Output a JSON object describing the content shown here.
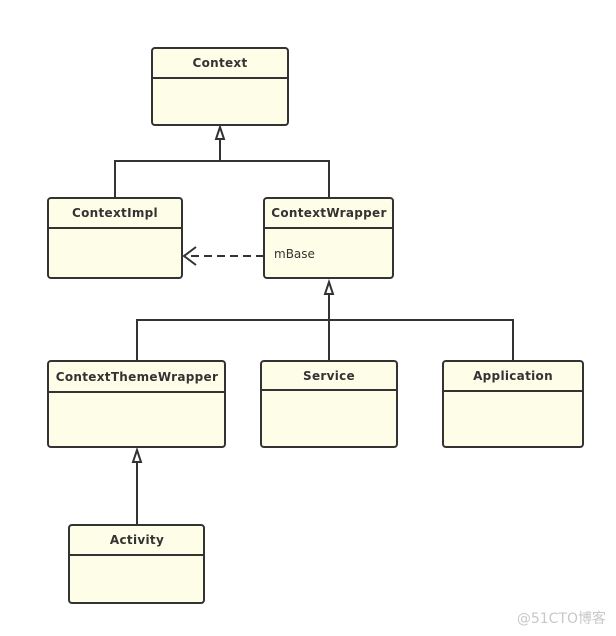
{
  "diagram": {
    "type": "uml-class-diagram",
    "classes": [
      {
        "id": "context",
        "name": "Context",
        "attributes": []
      },
      {
        "id": "contextimpl",
        "name": "ContextImpl",
        "attributes": []
      },
      {
        "id": "contextwrapper",
        "name": "ContextWrapper",
        "attributes": [
          "mBase"
        ]
      },
      {
        "id": "contextthemewrapper",
        "name": "ContextThemeWrapper",
        "attributes": []
      },
      {
        "id": "service",
        "name": "Service",
        "attributes": []
      },
      {
        "id": "application",
        "name": "Application",
        "attributes": []
      },
      {
        "id": "activity",
        "name": "Activity",
        "attributes": []
      }
    ],
    "relations": [
      {
        "from": "ContextImpl",
        "to": "Context",
        "kind": "inheritance"
      },
      {
        "from": "ContextWrapper",
        "to": "Context",
        "kind": "inheritance"
      },
      {
        "from": "ContextWrapper",
        "to": "ContextImpl",
        "kind": "dependency",
        "via": "mBase"
      },
      {
        "from": "ContextThemeWrapper",
        "to": "ContextWrapper",
        "kind": "inheritance"
      },
      {
        "from": "Service",
        "to": "ContextWrapper",
        "kind": "inheritance"
      },
      {
        "from": "Application",
        "to": "ContextWrapper",
        "kind": "inheritance"
      },
      {
        "from": "Activity",
        "to": "ContextThemeWrapper",
        "kind": "inheritance"
      }
    ]
  },
  "watermark": "@51CTO博客"
}
